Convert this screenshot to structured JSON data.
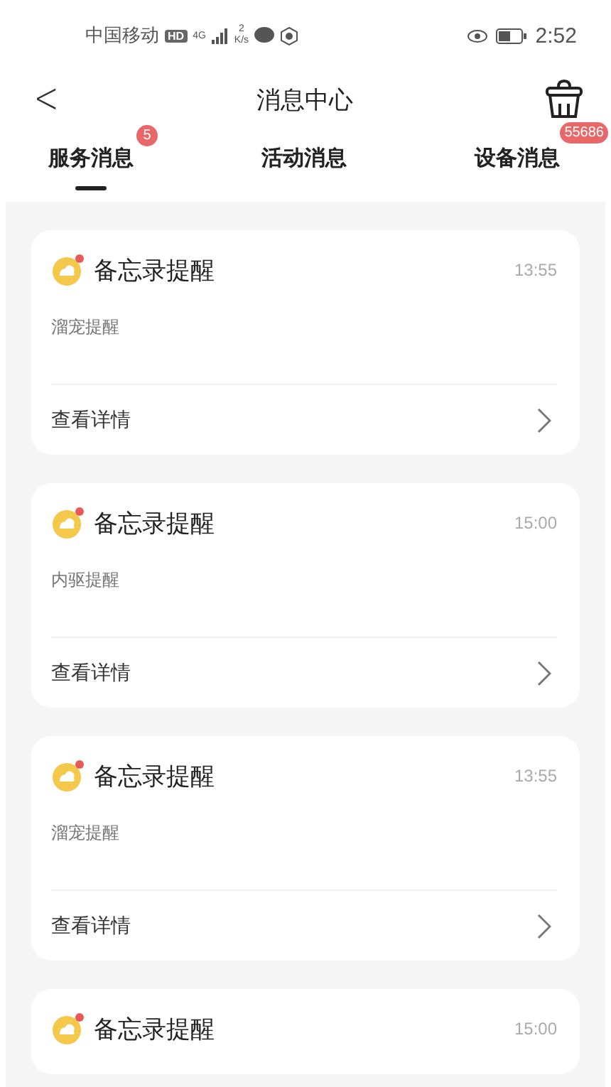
{
  "status_bar": {
    "carrier": "中国移动",
    "hd": "HD",
    "network": "4G",
    "speed_value": "2",
    "speed_unit": "K/s",
    "time": "2:52"
  },
  "header": {
    "back": "<",
    "title": "消息中心"
  },
  "tabs": [
    {
      "label": "服务消息",
      "selected": true,
      "badge": "5"
    },
    {
      "label": "活动消息",
      "selected": false
    },
    {
      "label": "设备消息",
      "selected": false,
      "badge": "55686"
    }
  ],
  "messages": [
    {
      "title": "备忘录提醒",
      "time": "13:55",
      "body": "溜宠提醒",
      "action": "查看详情"
    },
    {
      "title": "备忘录提醒",
      "time": "15:00",
      "body": "内驱提醒",
      "action": "查看详情"
    },
    {
      "title": "备忘录提醒",
      "time": "13:55",
      "body": "溜宠提醒",
      "action": "查看详情"
    },
    {
      "title": "备忘录提醒",
      "time": "15:00"
    }
  ]
}
